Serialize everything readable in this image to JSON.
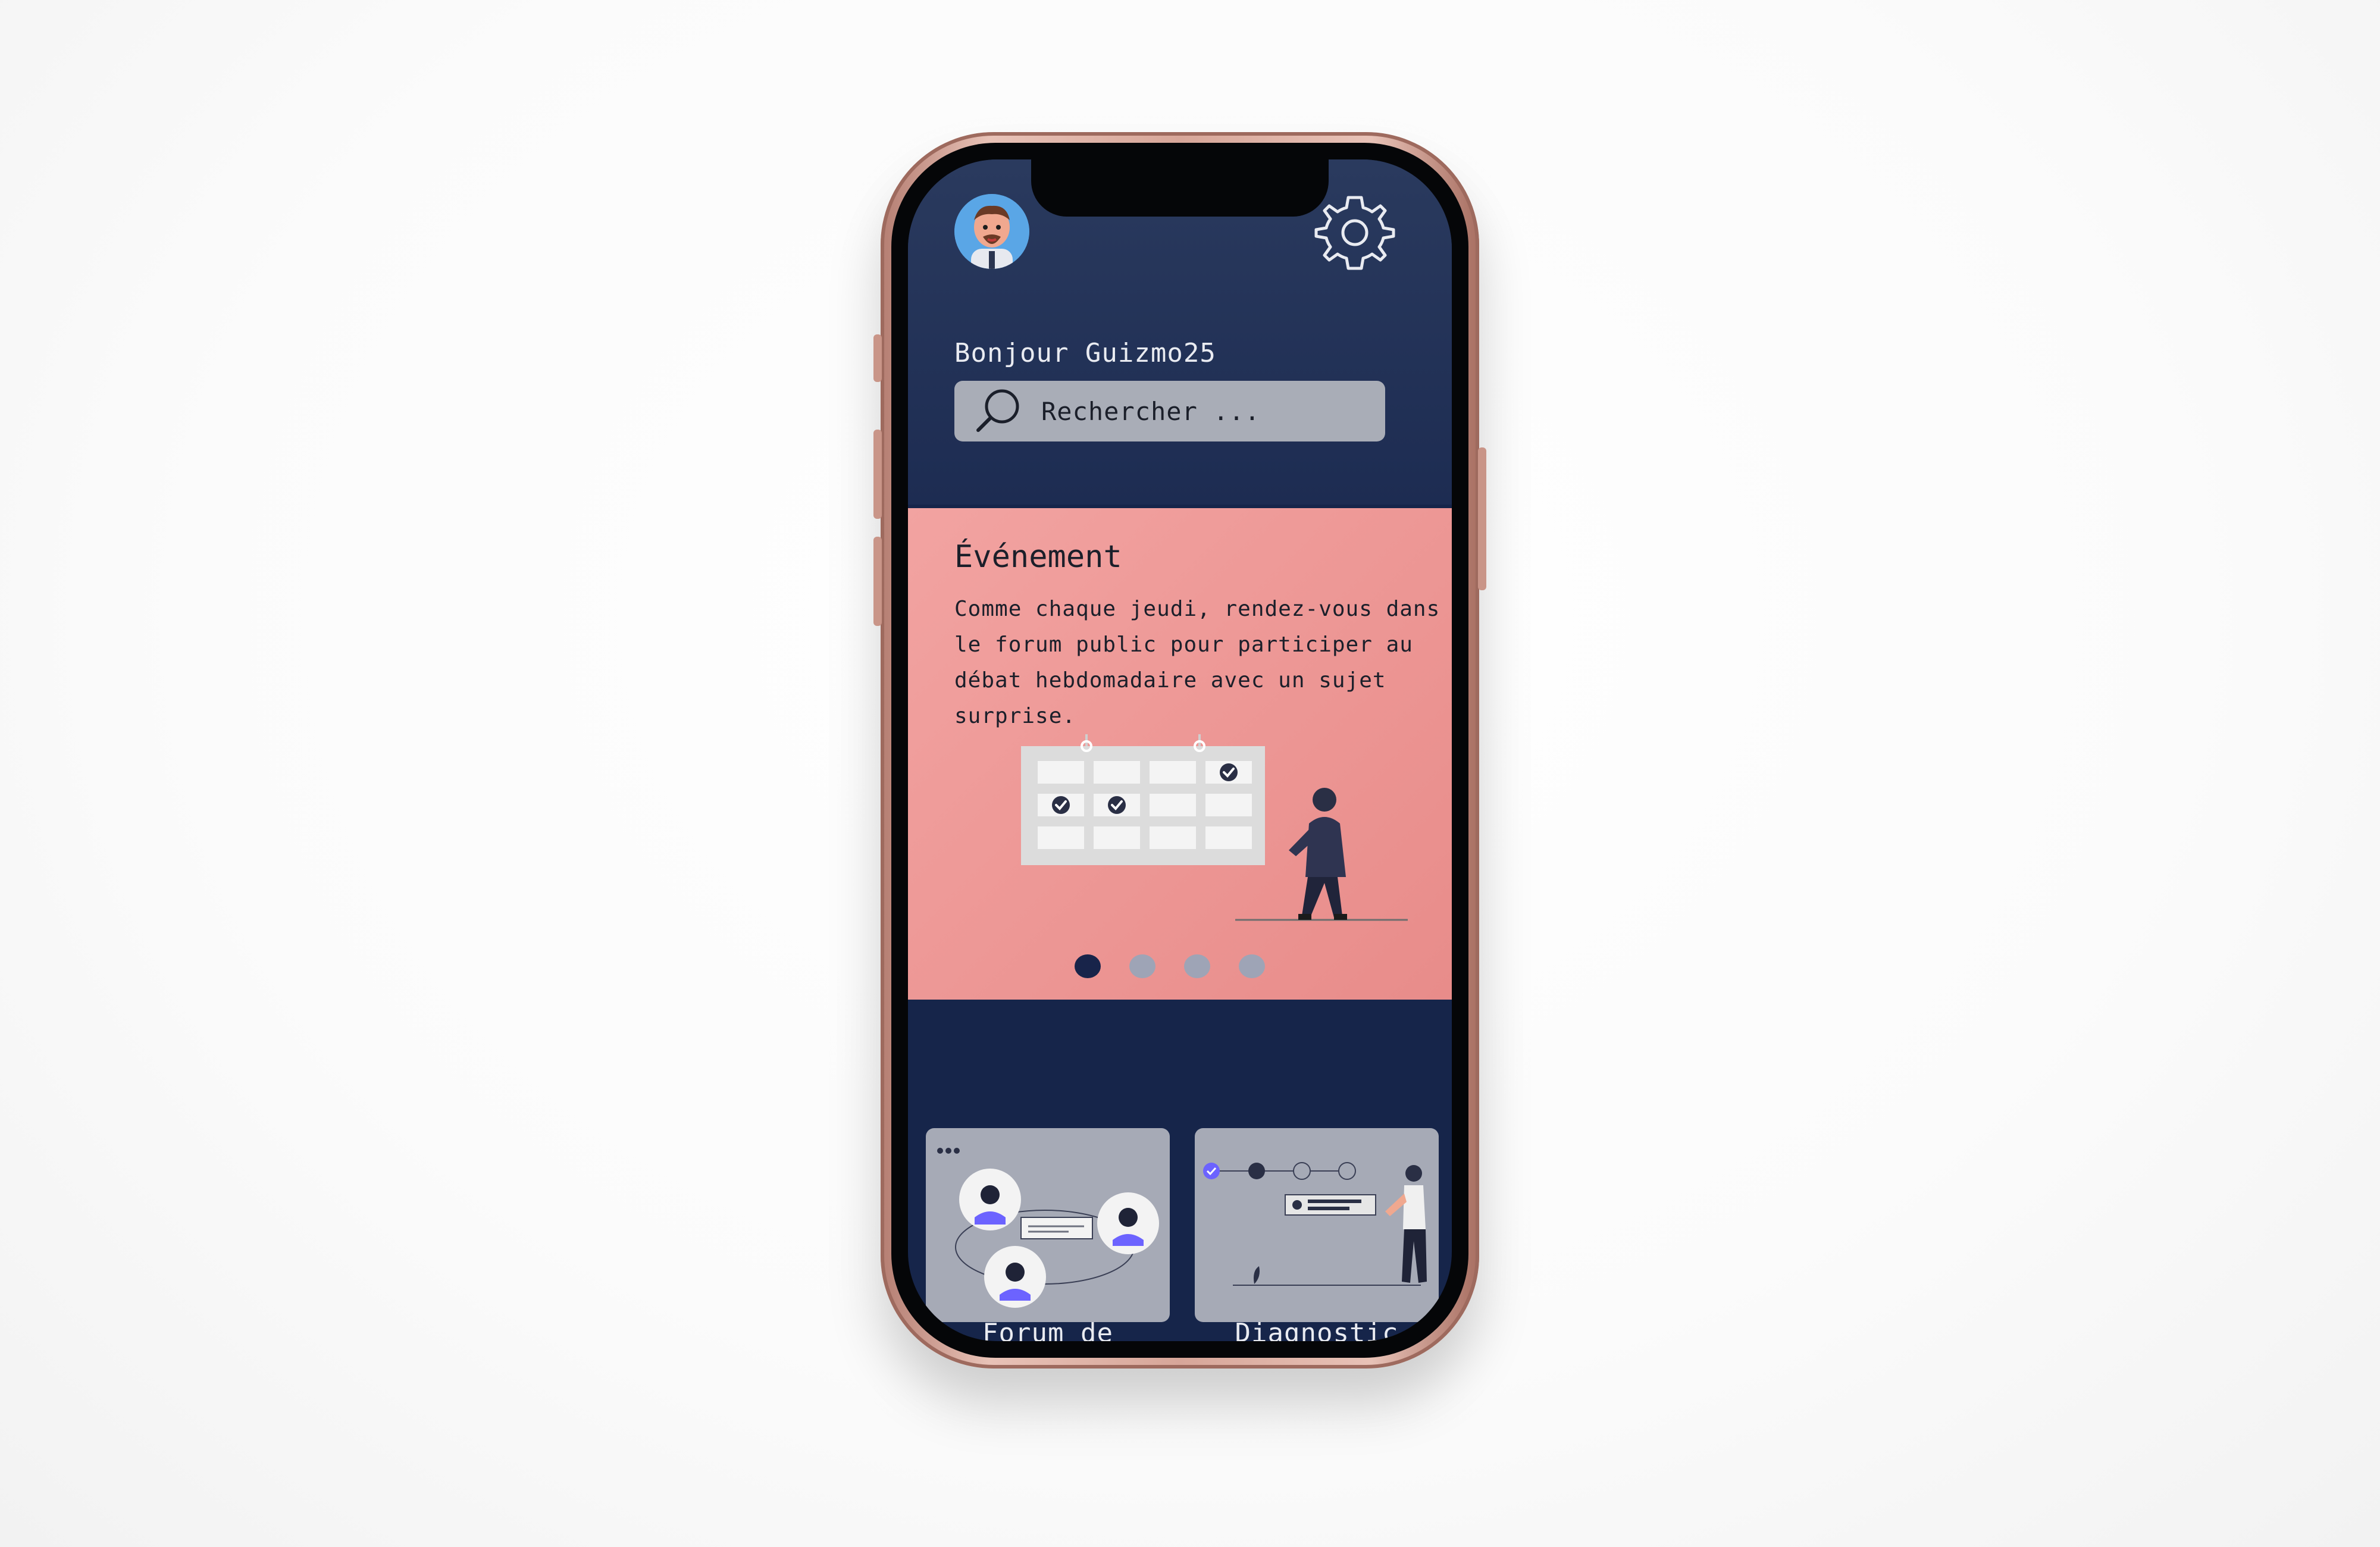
{
  "header": {
    "greeting": "Bonjour Guizmo25",
    "avatar_icon": "user-avatar-icon",
    "settings_icon": "gear-icon"
  },
  "search": {
    "placeholder": "Rechercher ..."
  },
  "event": {
    "title": "Événement",
    "body": "Comme chaque jeudi, rendez-vous dans le forum public pour participer au débat hebdomadaire avec un sujet surprise.",
    "carousel": {
      "total": 4,
      "active_index": 0
    }
  },
  "cards": [
    {
      "label": "Forum de",
      "icon": "forum-illustration"
    },
    {
      "label": "Diagnostic",
      "icon": "diagnostic-illustration"
    }
  ],
  "colors": {
    "screen_bg": "#16254a",
    "header_bg": "#2a3a5e",
    "event_bg": "#ee9896",
    "search_bg": "#a9adb7",
    "card_bg": "#a6aab6",
    "accent_dark": "#18244a"
  }
}
